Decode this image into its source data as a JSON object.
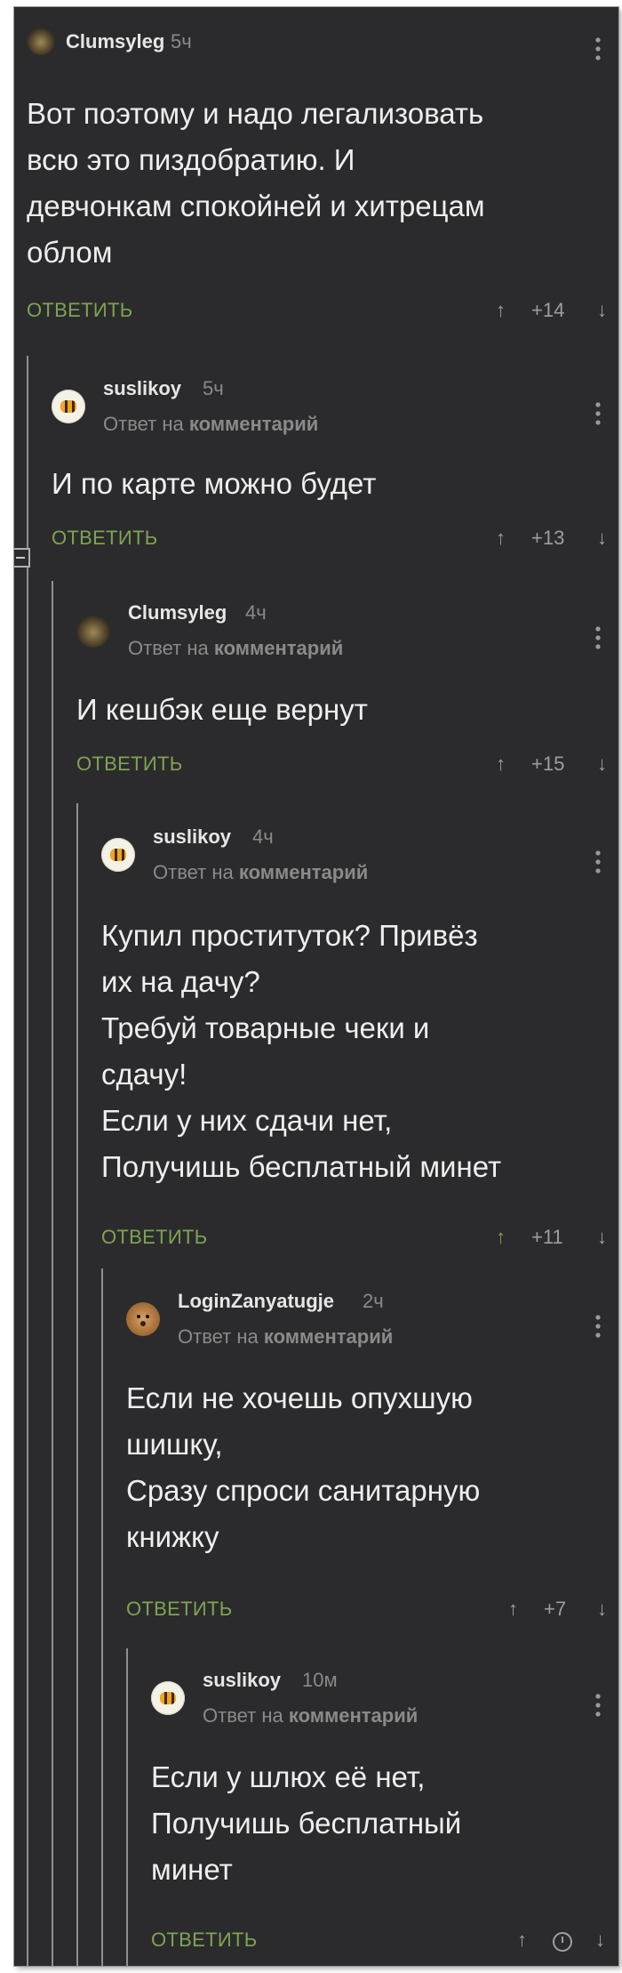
{
  "reply_label": "ОТВЕТИТЬ",
  "reply_to_prefix": "Ответ на",
  "reply_to_target": "комментарий",
  "colors": {
    "background": "#2b2b2d",
    "text": "#eeeeee",
    "accent_green": "#7ea452",
    "muted": "#8a8a8a"
  },
  "comments": [
    {
      "author": "Clumsyleg",
      "time": "5ч",
      "avatar": "castle-avatar",
      "lines": [
        "Вот поэтому и надо легализовать",
        "всю это пиздобратию. И",
        "девчонкам спокойней и хитрецам",
        "облом"
      ],
      "rating": "+14",
      "upvoted": false
    },
    {
      "author": "suslikoy",
      "time": "5ч",
      "avatar": "bee-avatar",
      "lines": [
        "И по карте можно будет"
      ],
      "rating": "+13",
      "upvoted": false
    },
    {
      "author": "Clumsyleg",
      "time": "4ч",
      "avatar": "castle-avatar",
      "lines": [
        "И кешбэк еще вернут"
      ],
      "rating": "+15",
      "upvoted": false
    },
    {
      "author": "suslikoy",
      "time": "4ч",
      "avatar": "bee-avatar",
      "lines": [
        "Купил проституток? Привёз",
        "их на дачу?",
        "Требуй товарные чеки и",
        "сдачу!",
        "Если у них сдачи нет,",
        "Получишь бесплатный минет"
      ],
      "rating": "+11",
      "upvoted": true
    },
    {
      "author": "LoginZanyatugje",
      "time": "2ч",
      "avatar": "hamster-avatar",
      "lines": [
        "Если не хочешь опухшую",
        "шишку,",
        "Сразу спроси санитарную",
        "книжку"
      ],
      "rating": "+7",
      "upvoted": false
    },
    {
      "author": "suslikoy",
      "time": "10м",
      "avatar": "bee-avatar",
      "lines": [
        "Если у шлюх её нет,",
        "Получишь бесплатный",
        "минет"
      ],
      "rating": "",
      "upvoted": false,
      "rating_pending": true
    }
  ],
  "icons": {
    "upvote": "↑",
    "downvote": "↓"
  }
}
